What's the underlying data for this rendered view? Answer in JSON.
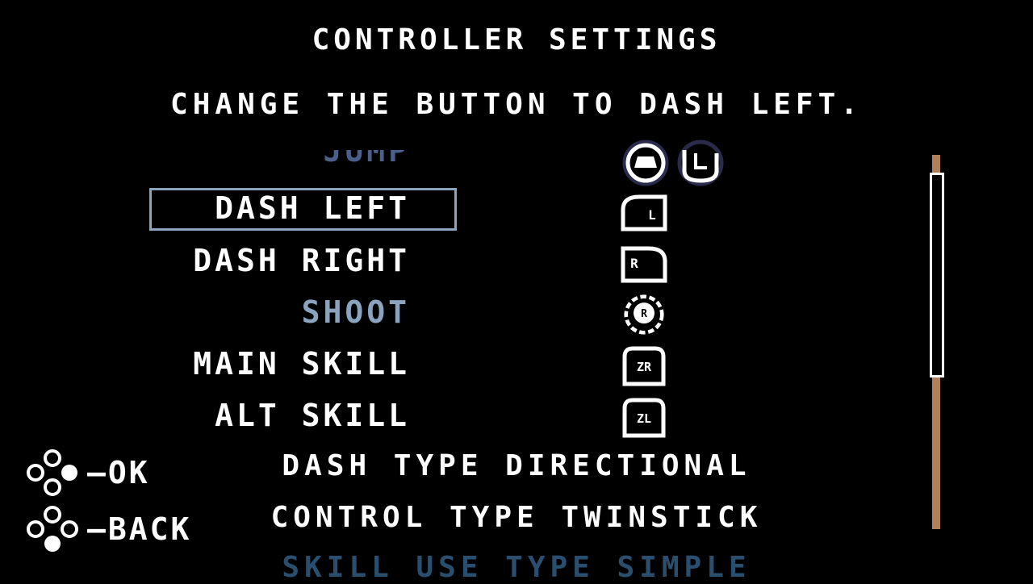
{
  "header": {
    "title": "CONTROLLER SETTINGS",
    "prompt": "CHANGE THE BUTTON TO DASH LEFT."
  },
  "actions": [
    {
      "label": "JUMP",
      "state": "faded",
      "glyph": "a-button-and-l-icon"
    },
    {
      "label": "DASH LEFT",
      "state": "selected",
      "glyph": "l-shoulder-icon"
    },
    {
      "label": "DASH RIGHT",
      "state": "normal",
      "glyph": "r-shoulder-icon"
    },
    {
      "label": "SHOOT",
      "state": "highlight",
      "glyph": "r-stick-icon"
    },
    {
      "label": "MAIN SKILL",
      "state": "normal",
      "glyph": "zr-trigger-icon"
    },
    {
      "label": "ALT SKILL",
      "state": "normal",
      "glyph": "zl-trigger-icon"
    }
  ],
  "options": [
    {
      "label": "DASH TYPE DIRECTIONAL"
    },
    {
      "label": "CONTROL TYPE TWINSTICK"
    },
    {
      "label": "SKILL USE TYPE SIMPLE",
      "state": "faded"
    }
  ],
  "hints": {
    "ok": "—OK",
    "back": "—BACK"
  },
  "glyph_labels": {
    "l": "L",
    "r": "R",
    "rstick": "R",
    "zr": "ZR",
    "zl": "ZL"
  },
  "colors": {
    "background": "#000000",
    "text": "#ffffff",
    "selection_border": "#8aa3bf",
    "highlight_text": "#8aa3bf",
    "faded_text": "#4a5f8a",
    "faded_option": "#2a4f6e",
    "scroll_track": "#b08058"
  },
  "scroll": {
    "thumb_start_fraction": 0.05,
    "thumb_size_fraction": 0.54
  }
}
